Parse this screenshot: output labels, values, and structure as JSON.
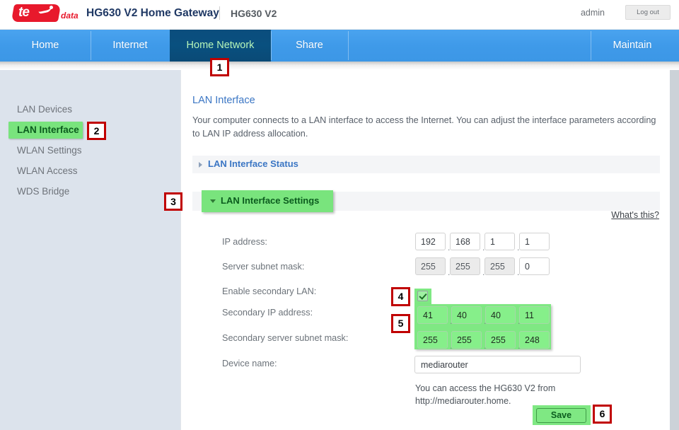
{
  "header": {
    "logo_text": "te",
    "logo_suffix": "data",
    "title": "HG630 V2 Home Gateway",
    "model": "HG630 V2",
    "user": "admin",
    "logout_label": "Log out"
  },
  "nav": {
    "items": [
      {
        "label": "Home",
        "active": false
      },
      {
        "label": "Internet",
        "active": false
      },
      {
        "label": "Home Network",
        "active": true
      },
      {
        "label": "Share",
        "active": false
      },
      {
        "label": "Maintain",
        "active": false
      }
    ]
  },
  "sidebar": {
    "items": [
      {
        "label": "LAN Devices",
        "active": false
      },
      {
        "label": "LAN Interface",
        "active": true
      },
      {
        "label": "WLAN Settings",
        "active": false
      },
      {
        "label": "WLAN Access",
        "active": false
      },
      {
        "label": "WDS Bridge",
        "active": false
      }
    ]
  },
  "main": {
    "page_title": "LAN Interface",
    "description": "Your computer connects to a LAN interface to access the Internet. You can adjust the interface parameters according to LAN IP address allocation.",
    "status_section_label": "LAN Interface Status",
    "settings_section_label": "LAN Interface Settings",
    "whats_this_label": "What's this?",
    "form": {
      "ip_address": {
        "label": "IP address:",
        "octets": [
          "192",
          "168",
          "1",
          "1"
        ],
        "disabled": [
          false,
          false,
          false,
          false
        ]
      },
      "server_subnet_mask": {
        "label": "Server subnet mask:",
        "octets": [
          "255",
          "255",
          "255",
          "0"
        ],
        "disabled": [
          true,
          true,
          true,
          false
        ]
      },
      "enable_secondary_lan": {
        "label": "Enable secondary LAN:",
        "checked": true
      },
      "secondary_ip_address": {
        "label": "Secondary IP address:",
        "octets": [
          "41",
          "40",
          "40",
          "11"
        ]
      },
      "secondary_server_subnet_mask": {
        "label": "Secondary server subnet mask:",
        "octets": [
          "255",
          "255",
          "255",
          "248"
        ]
      },
      "device_name": {
        "label": "Device name:",
        "value": "mediarouter",
        "placeholder": ""
      },
      "access_hint": "You can access the HG630 V2 from http://mediarouter.home.",
      "save_label": "Save"
    }
  },
  "annotations": [
    {
      "number": "1"
    },
    {
      "number": "2"
    },
    {
      "number": "3"
    },
    {
      "number": "4"
    },
    {
      "number": "5"
    },
    {
      "number": "6"
    }
  ],
  "colors": {
    "nav_blue": "#3f9ae9",
    "nav_active": "#0a4e7d",
    "highlight_green": "#7fe883",
    "annotation_red": "#c00000",
    "link_blue": "#3b76c4"
  }
}
